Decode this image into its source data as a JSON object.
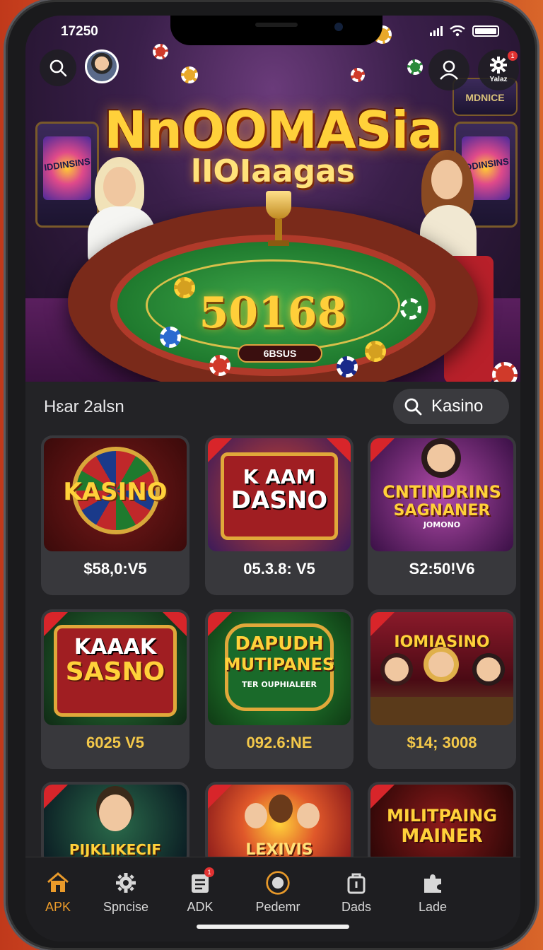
{
  "status_bar": {
    "time": "17250"
  },
  "hero": {
    "title_line1": "NnOOMASia",
    "title_line2": "lIOIaagas",
    "jackpot": "50168",
    "table_label": "6BSUS",
    "left_machine_label": "IDDINSINS",
    "right_machine_label": "IDDINSINS",
    "top_right_machine_label": "MDNICE",
    "settings_label": "Yalaz",
    "settings_badge": "1"
  },
  "section": {
    "title": "Hɛar 2alsn",
    "search_label": "Kasino"
  },
  "cards": [
    {
      "art_title": "KASINO",
      "price": "$58,0:V5"
    },
    {
      "art_title_1": "K AAM",
      "art_title_2": "DASNO",
      "price": "05.3.8: V5"
    },
    {
      "art_title_1": "CNTINDRINS",
      "art_title_2": "SAGNANER",
      "art_sub": "JOMONO",
      "price": "S2:50!V6"
    },
    {
      "art_title_1": "KAAAK",
      "art_title_2": "SASNO",
      "price": "6025 V5"
    },
    {
      "art_title_1": "DAPUDH",
      "art_title_2": "MUTIPANES",
      "art_sub": "TER OUPHIALEER",
      "price": "092.6:NE"
    },
    {
      "art_title": "IOMIASINO",
      "price": "$14; 3008"
    },
    {
      "art_title": "PIJKLIKECIF"
    },
    {
      "art_title": "LEXIVIS"
    },
    {
      "art_title_1": "MILITPAING",
      "art_title_2": "MAINER"
    }
  ],
  "nav": [
    {
      "label": "APK",
      "icon": "home-icon",
      "active": true
    },
    {
      "label": "Spncise",
      "icon": "gear-icon"
    },
    {
      "label": "ADK",
      "icon": "document-icon",
      "badge": "1"
    },
    {
      "label": "Pedemr",
      "icon": "chip-icon"
    },
    {
      "label": "Dads",
      "icon": "bag-icon"
    },
    {
      "label": "Lade",
      "icon": "puzzle-icon"
    }
  ],
  "colors": {
    "accent": "#e99a2a",
    "gold": "#f3c84a",
    "card_bg": "#38383c",
    "screen_bg": "#232326"
  }
}
